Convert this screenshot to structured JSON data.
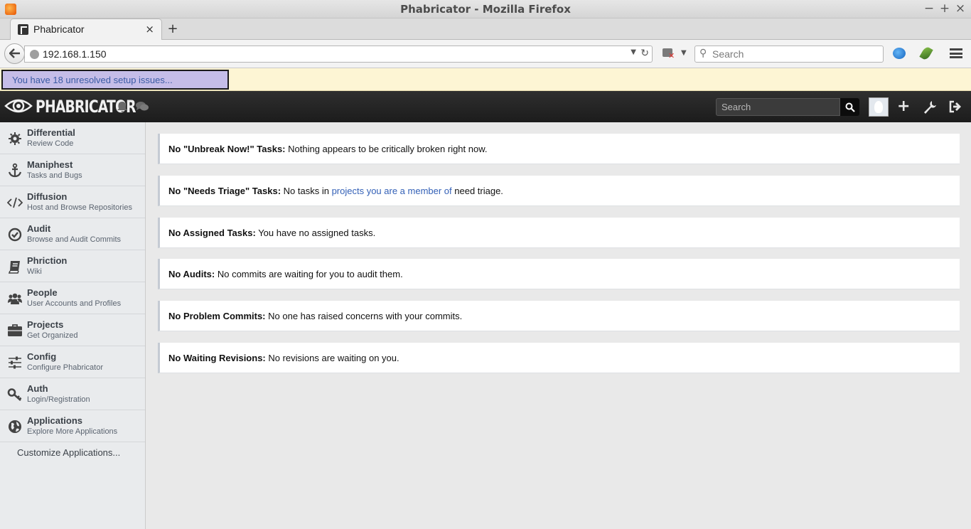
{
  "window": {
    "title": "Phabricator - Mozilla Firefox",
    "controls": [
      "−",
      "+",
      "×"
    ]
  },
  "tabs": [
    {
      "label": "Phabricator",
      "close": "×"
    }
  ],
  "new_tab": "+",
  "nav": {
    "url": "192.168.1.150",
    "search_placeholder": "Search"
  },
  "setup": {
    "issues_text": "You have 18 unresolved setup issues..."
  },
  "header": {
    "logo_text": "PHABRICATOR",
    "search_placeholder": "Search"
  },
  "sidebar": {
    "items": [
      {
        "name": "Differential",
        "desc": "Review Code",
        "icon": "gear-icon"
      },
      {
        "name": "Maniphest",
        "desc": "Tasks and Bugs",
        "icon": "anchor-icon"
      },
      {
        "name": "Diffusion",
        "desc": "Host and Browse Repositories",
        "icon": "code-icon"
      },
      {
        "name": "Audit",
        "desc": "Browse and Audit Commits",
        "icon": "check-circle-icon"
      },
      {
        "name": "Phriction",
        "desc": "Wiki",
        "icon": "book-icon"
      },
      {
        "name": "People",
        "desc": "User Accounts and Profiles",
        "icon": "users-icon"
      },
      {
        "name": "Projects",
        "desc": "Get Organized",
        "icon": "briefcase-icon"
      },
      {
        "name": "Config",
        "desc": "Configure Phabricator",
        "icon": "sliders-icon"
      },
      {
        "name": "Auth",
        "desc": "Login/Registration",
        "icon": "key-icon"
      },
      {
        "name": "Applications",
        "desc": "Explore More Applications",
        "icon": "globe-icon"
      }
    ],
    "customize": "Customize Applications..."
  },
  "panels": [
    {
      "title": "No \"Unbreak Now!\" Tasks:",
      "text": " Nothing appears to be critically broken right now."
    },
    {
      "title": "No \"Needs Triage\" Tasks:",
      "text_before": " No tasks in ",
      "link": "projects you are a member of",
      "text_after": " need triage."
    },
    {
      "title": "No Assigned Tasks:",
      "text": " You have no assigned tasks."
    },
    {
      "title": "No Audits:",
      "text": " No commits are waiting for you to audit them."
    },
    {
      "title": "No Problem Commits:",
      "text": " No one has raised concerns with your commits."
    },
    {
      "title": "No Waiting Revisions:",
      "text": " No revisions are waiting on you."
    }
  ]
}
